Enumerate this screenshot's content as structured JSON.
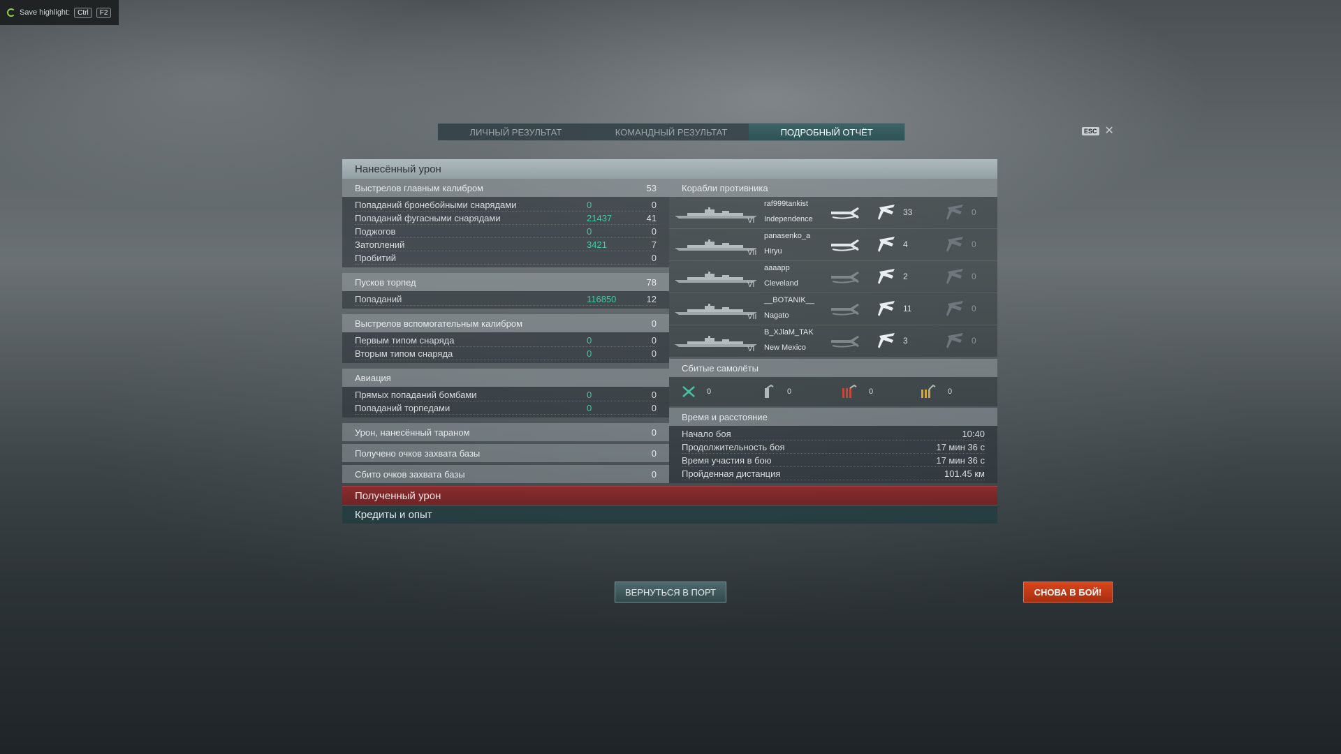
{
  "highlight": {
    "label": "Save highlight:",
    "key1": "Ctrl",
    "key2": "F2"
  },
  "tabs": {
    "personal": "ЛИЧНЫЙ РЕЗУЛЬТАТ",
    "team": "КОМАНДНЫЙ РЕЗУЛЬТАТ",
    "detailed": "ПОДРОБНЫЙ ОТЧЁТ"
  },
  "esc": {
    "key": "ESC"
  },
  "dealt": {
    "title": "Нанесённый урон",
    "main": {
      "label": "Выстрелов главным калибром",
      "value": "53",
      "rows": [
        {
          "label": "Попаданий бронебойными снарядами",
          "dmg": "0",
          "count": "0"
        },
        {
          "label": "Попаданий фугасными снарядами",
          "dmg": "21437",
          "count": "41"
        },
        {
          "label": "Поджогов",
          "dmg": "0",
          "count": "0"
        },
        {
          "label": "Затоплений",
          "dmg": "3421",
          "count": "7"
        },
        {
          "label": "Пробитий",
          "dmg": "",
          "count": "0"
        }
      ]
    },
    "torp": {
      "label": "Пусков торпед",
      "value": "78",
      "rows": [
        {
          "label": "Попаданий",
          "dmg": "116850",
          "count": "12"
        }
      ]
    },
    "secondary": {
      "label": "Выстрелов вспомогательным калибром",
      "value": "0",
      "rows": [
        {
          "label": "Первым типом снаряда",
          "dmg": "0",
          "count": "0"
        },
        {
          "label": "Вторым типом снаряда",
          "dmg": "0",
          "count": "0"
        }
      ]
    },
    "aviation": {
      "label": "Авиация",
      "rows": [
        {
          "label": "Прямых попаданий бомбами",
          "dmg": "0",
          "count": "0"
        },
        {
          "label": "Попаданий торпедами",
          "dmg": "0",
          "count": "0"
        }
      ]
    },
    "ram": {
      "label": "Урон, нанесённый тараном",
      "value": "0"
    },
    "capture": {
      "label": "Получено очков захвата базы",
      "value": "0"
    },
    "defense": {
      "label": "Сбито очков захвата базы",
      "value": "0"
    }
  },
  "enemies": {
    "title": "Корабли противника",
    "ships": [
      {
        "player": "raf999tankist",
        "ship": "Independence",
        "tier": "VI",
        "spotted": "33",
        "other": "0"
      },
      {
        "player": "panasenko_a",
        "ship": "Hiryu",
        "tier": "VII",
        "spotted": "4",
        "other": "0"
      },
      {
        "player": "aaaapp",
        "ship": "Cleveland",
        "tier": "VI",
        "spotted": "2",
        "other": "0"
      },
      {
        "player": "__BOTANIK__",
        "ship": "Nagato",
        "tier": "VII",
        "spotted": "11",
        "other": "0"
      },
      {
        "player": "B_XJlaM_TAK",
        "ship": "New Mexico",
        "tier": "VI",
        "spotted": "3",
        "other": "0"
      }
    ]
  },
  "planes": {
    "title": "Сбитые самолёты",
    "values": [
      "0",
      "0",
      "0",
      "0"
    ]
  },
  "time": {
    "title": "Время и расстояние",
    "rows": [
      {
        "label": "Начало боя",
        "value": "10:40"
      },
      {
        "label": "Продолжительность боя",
        "value": "17 мин 36 с"
      },
      {
        "label": "Время участия в бою",
        "value": "17 мин 36 с"
      },
      {
        "label": "Пройденная дистанция",
        "value": "101.45 км"
      }
    ]
  },
  "received": {
    "title": "Полученный урон"
  },
  "credits": {
    "title": "Кредиты и опыт"
  },
  "buttons": {
    "port": "ВЕРНУТЬСЯ В ПОРТ",
    "fight": "СНОВА В БОЙ!"
  }
}
